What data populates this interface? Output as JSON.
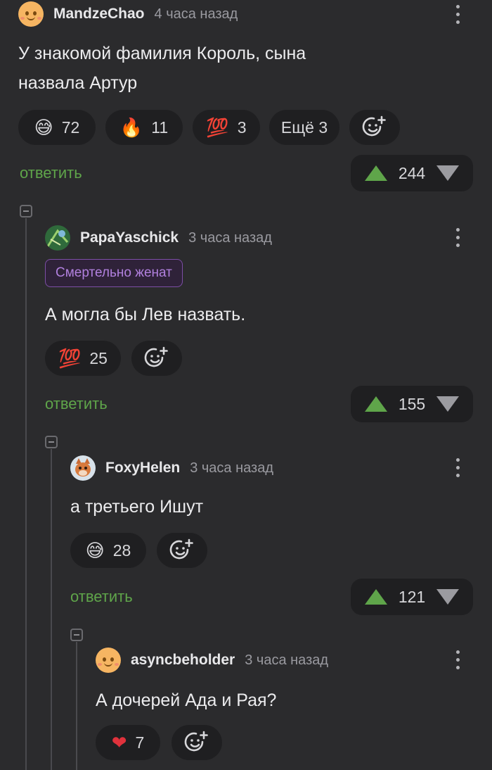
{
  "comments": [
    {
      "username": "MandzeChao",
      "time": "4 часа назад",
      "text_line1": "У знакомой фамилия Король, сына",
      "text_line2": "назвала Артур",
      "reactions": [
        {
          "emoji_name": "grinning-sweat-icon",
          "emoji": "😅",
          "count": "72"
        },
        {
          "emoji_name": "fire-icon",
          "emoji": "🔥",
          "count": "11"
        },
        {
          "emoji_name": "hundred-icon",
          "emoji": "💯",
          "count": "3"
        }
      ],
      "more_reactions": "Ещё 3",
      "reply_label": "ответить",
      "votes": "244"
    },
    {
      "username": "PapaYaschick",
      "time": "3 часа назад",
      "badge": "Смертельно женат",
      "text": "А могла бы Лев назвать.",
      "reactions": [
        {
          "emoji_name": "hundred-five-hundred-icon",
          "emoji": "💯",
          "count": "25"
        }
      ],
      "reply_label": "ответить",
      "votes": "155"
    },
    {
      "username": "FoxyHelen",
      "time": "3 часа назад",
      "text": "а третьего Ишут",
      "reactions": [
        {
          "emoji_name": "grinning-sweat-icon",
          "emoji": "😅",
          "count": "28"
        }
      ],
      "reply_label": "ответить",
      "votes": "121"
    },
    {
      "username": "asyncbeholder",
      "time": "3 часа назад",
      "text": "А дочерей Ада и Рая?",
      "reactions": [
        {
          "emoji_name": "heart-icon",
          "emoji": "❤",
          "count": "7"
        }
      ]
    }
  ],
  "colors": {
    "background": "#2b2b2d",
    "chip": "#1f1f21",
    "accent_green": "#5fa54a",
    "badge_purple": "#b180de"
  }
}
